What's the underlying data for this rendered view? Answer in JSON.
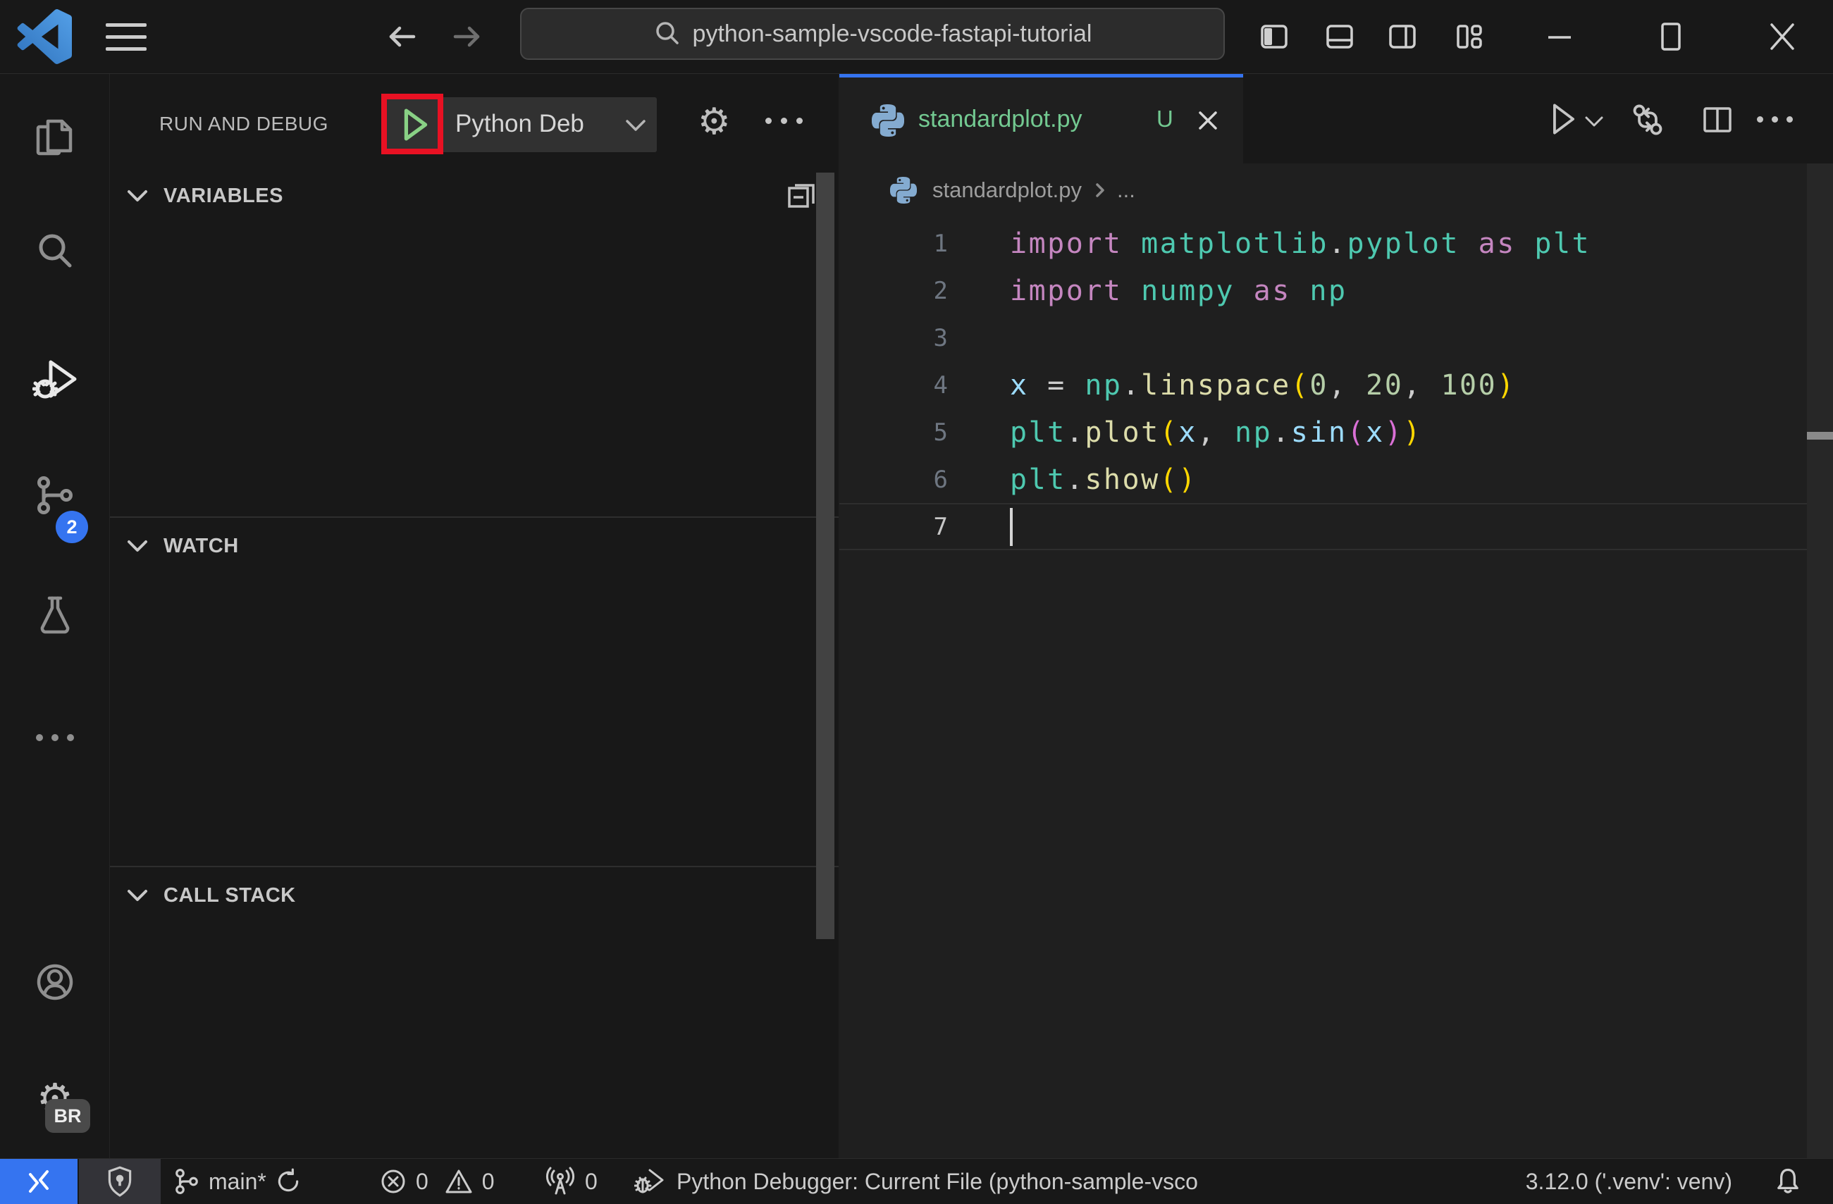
{
  "colors": {
    "accent_blue": "#3574f0",
    "annotation_red": "#e81123",
    "run_green": "#89d185",
    "untracked_green": "#73c991",
    "editor_bg": "#1f1f1f",
    "shell_bg": "#181818"
  },
  "title_bar": {
    "command_center_value": "python-sample-vscode-fastapi-tutorial"
  },
  "activity_bar": {
    "source_control_badge": "2",
    "profile_badge": "BR"
  },
  "sidebar": {
    "title": "RUN AND DEBUG",
    "debug_config_label": "Python Deb",
    "sections": [
      {
        "label": "VARIABLES"
      },
      {
        "label": "WATCH"
      },
      {
        "label": "CALL STACK"
      }
    ]
  },
  "editor": {
    "tab": {
      "label": "standardplot.py",
      "dirty_indicator": "U"
    },
    "breadcrumb": {
      "file": "standardplot.py",
      "symbol": "..."
    },
    "code_lines": [
      {
        "num": "1",
        "tokens": [
          {
            "t": "import",
            "c": "kw"
          },
          {
            "t": " ",
            "c": "op"
          },
          {
            "t": "matplotlib",
            "c": "mod"
          },
          {
            "t": ".",
            "c": "op"
          },
          {
            "t": "pyplot",
            "c": "mod"
          },
          {
            "t": " ",
            "c": "op"
          },
          {
            "t": "as",
            "c": "kw"
          },
          {
            "t": " ",
            "c": "op"
          },
          {
            "t": "plt",
            "c": "mod"
          }
        ]
      },
      {
        "num": "2",
        "tokens": [
          {
            "t": "import",
            "c": "kw"
          },
          {
            "t": " ",
            "c": "op"
          },
          {
            "t": "numpy",
            "c": "mod"
          },
          {
            "t": " ",
            "c": "op"
          },
          {
            "t": "as",
            "c": "kw"
          },
          {
            "t": " ",
            "c": "op"
          },
          {
            "t": "np",
            "c": "mod"
          }
        ]
      },
      {
        "num": "3",
        "tokens": []
      },
      {
        "num": "4",
        "tokens": [
          {
            "t": "x",
            "c": "var"
          },
          {
            "t": " = ",
            "c": "op"
          },
          {
            "t": "np",
            "c": "mod"
          },
          {
            "t": ".",
            "c": "op"
          },
          {
            "t": "linspace",
            "c": "fn"
          },
          {
            "t": "(",
            "c": "b1"
          },
          {
            "t": "0",
            "c": "num"
          },
          {
            "t": ", ",
            "c": "op"
          },
          {
            "t": "20",
            "c": "num"
          },
          {
            "t": ", ",
            "c": "op"
          },
          {
            "t": "100",
            "c": "num"
          },
          {
            "t": ")",
            "c": "b1"
          }
        ]
      },
      {
        "num": "5",
        "tokens": [
          {
            "t": "plt",
            "c": "mod"
          },
          {
            "t": ".",
            "c": "op"
          },
          {
            "t": "plot",
            "c": "fn"
          },
          {
            "t": "(",
            "c": "b1"
          },
          {
            "t": "x",
            "c": "var"
          },
          {
            "t": ", ",
            "c": "op"
          },
          {
            "t": "np",
            "c": "mod"
          },
          {
            "t": ".",
            "c": "op"
          },
          {
            "t": "sin",
            "c": "var"
          },
          {
            "t": "(",
            "c": "b2"
          },
          {
            "t": "x",
            "c": "var"
          },
          {
            "t": ")",
            "c": "b2"
          },
          {
            "t": ")",
            "c": "b1"
          }
        ]
      },
      {
        "num": "6",
        "tokens": [
          {
            "t": "plt",
            "c": "mod"
          },
          {
            "t": ".",
            "c": "op"
          },
          {
            "t": "show",
            "c": "fn"
          },
          {
            "t": "(",
            "c": "b1"
          },
          {
            "t": ")",
            "c": "b1"
          }
        ]
      },
      {
        "num": "7",
        "tokens": [],
        "current": true,
        "cursor": true
      }
    ]
  },
  "status_bar": {
    "branch": "main*",
    "errors": "0",
    "warnings": "0",
    "ports": "0",
    "debug_status": "Python Debugger: Current File (python-sample-vsco",
    "interpreter": "3.12.0 ('.venv': venv)"
  }
}
